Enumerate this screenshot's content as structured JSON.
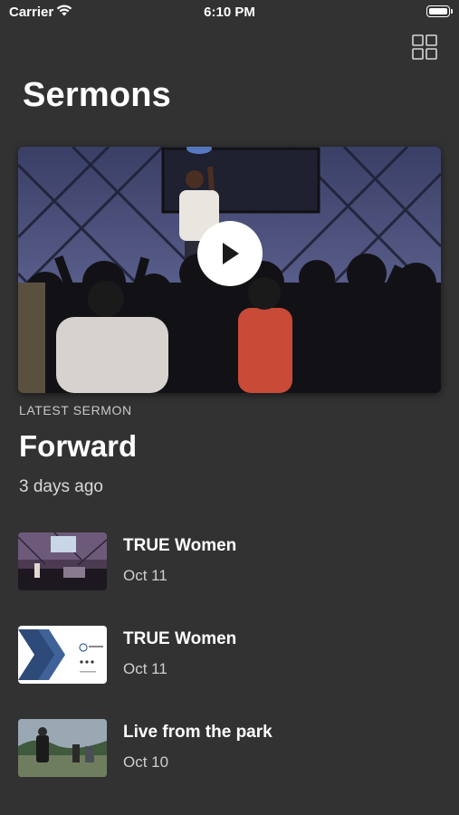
{
  "status_bar": {
    "carrier": "Carrier",
    "time": "6:10 PM"
  },
  "header": {
    "title": "Sermons",
    "view_toggle_icon": "grid-icon"
  },
  "latest": {
    "label": "LATEST SERMON",
    "title": "Forward",
    "date": "3 days ago"
  },
  "sermons": [
    {
      "title": "TRUE Women",
      "date": "Oct 11"
    },
    {
      "title": "TRUE Women",
      "date": "Oct 11"
    },
    {
      "title": "Live from the park",
      "date": "Oct 10"
    }
  ],
  "colors": {
    "background": "#323232",
    "text": "#ffffff",
    "secondary_text": "#cfcfcf"
  }
}
